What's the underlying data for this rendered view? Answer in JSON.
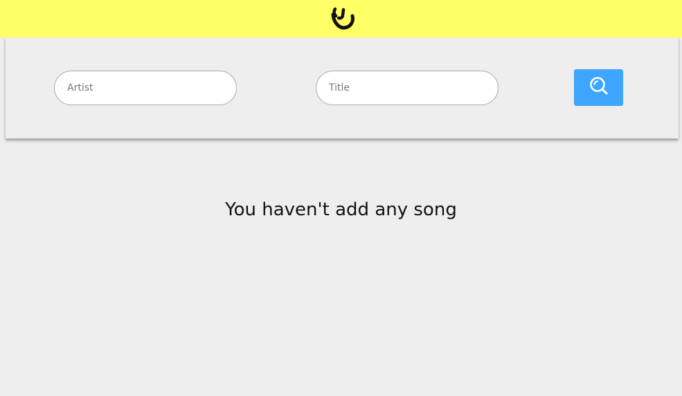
{
  "header": {
    "background_color": "#ffff66",
    "logo_icon": "smiley-logo-icon"
  },
  "search": {
    "artist_placeholder": "Artist",
    "artist_value": "",
    "title_placeholder": "Title",
    "title_value": "",
    "button_icon": "search-icon",
    "button_color": "#3ea6ff"
  },
  "main": {
    "empty_message": "You haven't add any song"
  }
}
